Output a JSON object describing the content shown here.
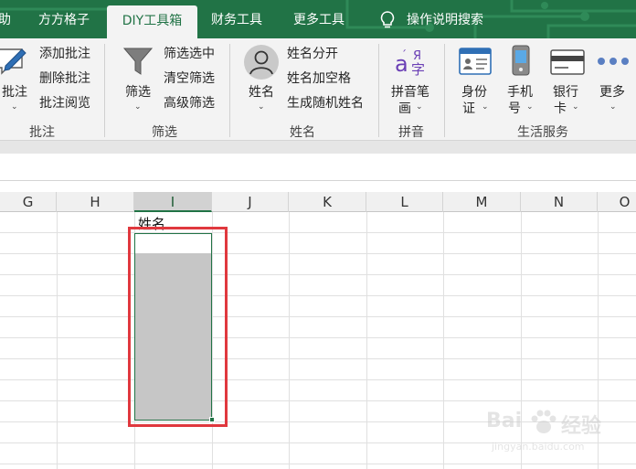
{
  "tabs": [
    {
      "label": "助",
      "active": false
    },
    {
      "label": "方方格子",
      "active": false
    },
    {
      "label": "DIY工具箱",
      "active": true
    },
    {
      "label": "财务工具",
      "active": false
    },
    {
      "label": "更多工具",
      "active": false
    }
  ],
  "tell_me": {
    "label": "操作说明搜索",
    "icon": "lightbulb-icon"
  },
  "ribbon": {
    "comment": {
      "big_label": "批注",
      "big_icon": "comment-pen-icon",
      "items": [
        "添加批注",
        "删除批注",
        "批注阅览"
      ],
      "group_label": "批注"
    },
    "filter": {
      "big_label": "筛选",
      "big_icon": "funnel-icon",
      "items": [
        "筛选选中",
        "清空筛选",
        "高级筛选"
      ],
      "group_label": "筛选"
    },
    "name": {
      "big_label": "姓名",
      "big_icon": "person-icon",
      "items": [
        "姓名分开",
        "姓名加空格",
        "生成随机姓名"
      ],
      "group_label": "姓名"
    },
    "pinyin": {
      "big_label_line1": "拼音笔",
      "big_label_line2": "画",
      "big_icon": "pinyin-icon",
      "group_label": "拼音"
    },
    "life": {
      "buttons": [
        {
          "line1": "身份",
          "line2": "证",
          "icon": "id-card-icon"
        },
        {
          "line1": "手机",
          "line2": "号",
          "icon": "mobile-phone-icon"
        },
        {
          "line1": "银行",
          "line2": "卡",
          "icon": "bank-card-icon"
        },
        {
          "line1": "更多",
          "line2": "",
          "icon": "more-dots-icon"
        }
      ],
      "group_label": "生活服务"
    }
  },
  "grid": {
    "columns": [
      "G",
      "H",
      "I",
      "J",
      "K",
      "L",
      "M",
      "N",
      "O"
    ],
    "selected_column": "I",
    "header_cell_text": "姓名"
  },
  "watermark": {
    "brand": "Bai",
    "brand2": "经验",
    "url": "jingyan.baidu.com"
  },
  "colors": {
    "accent": "#217346",
    "highlight": "#e0383e",
    "selection_fill": "#c6c6c6"
  }
}
